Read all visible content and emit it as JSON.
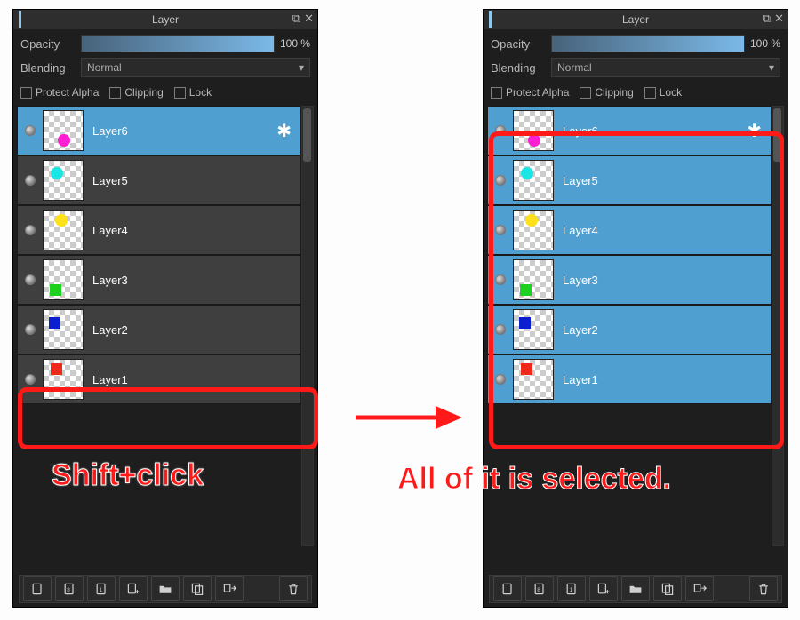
{
  "panel_title": "Layer",
  "opacity": {
    "label": "Opacity",
    "value_text": "100 %"
  },
  "blending": {
    "label": "Blending",
    "value": "Normal"
  },
  "checks": {
    "protect_alpha": "Protect Alpha",
    "clipping": "Clipping",
    "lock": "Lock"
  },
  "layers": [
    {
      "name": "Layer6",
      "shape": "circle",
      "color": "#ff1fd3",
      "pos": "l6",
      "has_gear": true
    },
    {
      "name": "Layer5",
      "shape": "circle",
      "color": "#1be6e6",
      "pos": "l5",
      "has_gear": false
    },
    {
      "name": "Layer4",
      "shape": "circle",
      "color": "#ffe11a",
      "pos": "l4",
      "has_gear": false
    },
    {
      "name": "Layer3",
      "shape": "square",
      "color": "#1ed11e",
      "pos": "l3",
      "has_gear": false
    },
    {
      "name": "Layer2",
      "shape": "square",
      "color": "#0b1ed0",
      "pos": "l2",
      "has_gear": false
    },
    {
      "name": "Layer1",
      "shape": "square",
      "color": "#ef2a1a",
      "pos": "l1",
      "has_gear": false
    }
  ],
  "left_selected": [
    0
  ],
  "right_selected": [
    0,
    1,
    2,
    3,
    4,
    5
  ],
  "captions": {
    "shift_click": "Shift+click",
    "all_selected": "All of it is selected."
  },
  "toolbar_icons": [
    "new-layer",
    "new-8bit",
    "new-1bit",
    "add-special",
    "folder",
    "duplicate",
    "merge",
    "trash"
  ]
}
